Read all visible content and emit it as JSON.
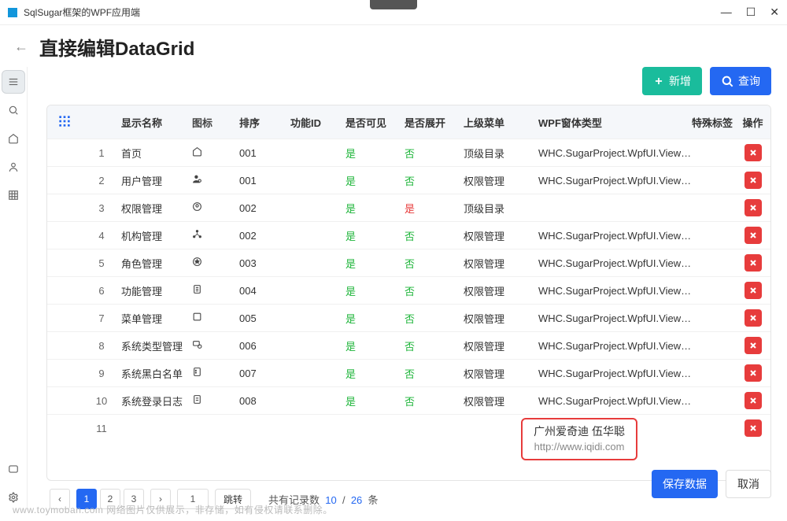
{
  "window": {
    "title": "SqlSugar框架的WPF应用端"
  },
  "page": {
    "title": "直接编辑DataGrid"
  },
  "actions": {
    "add": "新增",
    "search": "查询",
    "save": "保存数据",
    "cancel": "取消"
  },
  "grid": {
    "headers": {
      "name": "显示名称",
      "icon": "图标",
      "sort": "排序",
      "func_id": "功能ID",
      "visible": "是否可见",
      "expand": "是否展开",
      "parent": "上级菜单",
      "winform": "WPF窗体类型",
      "tag": "特殊标签",
      "op": "操作"
    },
    "rows": [
      {
        "idx": "1",
        "name": "首页",
        "icon": "home",
        "sort": "001",
        "visible": "是",
        "expand": "否",
        "parent": "顶级目录",
        "winform": "WHC.SugarProject.WpfUI.Views...."
      },
      {
        "idx": "2",
        "name": "用户管理",
        "icon": "user",
        "sort": "001",
        "visible": "是",
        "expand": "否",
        "parent": "权限管理",
        "winform": "WHC.SugarProject.WpfUI.Views...."
      },
      {
        "idx": "3",
        "name": "权限管理",
        "icon": "shield",
        "sort": "002",
        "visible": "是",
        "expand": "是",
        "parent": "顶级目录",
        "winform": ""
      },
      {
        "idx": "4",
        "name": "机构管理",
        "icon": "org",
        "sort": "002",
        "visible": "是",
        "expand": "否",
        "parent": "权限管理",
        "winform": "WHC.SugarProject.WpfUI.Views...."
      },
      {
        "idx": "5",
        "name": "角色管理",
        "icon": "role",
        "sort": "003",
        "visible": "是",
        "expand": "否",
        "parent": "权限管理",
        "winform": "WHC.SugarProject.WpfUI.Views...."
      },
      {
        "idx": "6",
        "name": "功能管理",
        "icon": "func",
        "sort": "004",
        "visible": "是",
        "expand": "否",
        "parent": "权限管理",
        "winform": "WHC.SugarProject.WpfUI.Views...."
      },
      {
        "idx": "7",
        "name": "菜单管理",
        "icon": "menu",
        "sort": "005",
        "visible": "是",
        "expand": "否",
        "parent": "权限管理",
        "winform": "WHC.SugarProject.WpfUI.Views...."
      },
      {
        "idx": "8",
        "name": "系统类型管理",
        "icon": "sys",
        "sort": "006",
        "visible": "是",
        "expand": "否",
        "parent": "权限管理",
        "winform": "WHC.SugarProject.WpfUI.Views...."
      },
      {
        "idx": "9",
        "name": "系统黑白名单",
        "icon": "list",
        "sort": "007",
        "visible": "是",
        "expand": "否",
        "parent": "权限管理",
        "winform": "WHC.SugarProject.WpfUI.Views...."
      },
      {
        "idx": "10",
        "name": "系统登录日志",
        "icon": "log",
        "sort": "008",
        "visible": "是",
        "expand": "否",
        "parent": "权限管理",
        "winform": "WHC.SugarProject.WpfUI.Views...."
      },
      {
        "idx": "11",
        "name": "",
        "icon": "",
        "sort": "",
        "visible": "",
        "expand": "",
        "parent": "",
        "winform": ""
      }
    ]
  },
  "pager": {
    "pages": [
      "1",
      "2",
      "3"
    ],
    "active": "1",
    "goto": "1",
    "jump": "跳转",
    "total_label_prefix": "共有记录数",
    "total": "10",
    "sep": "/",
    "page_total": "26",
    "total_label_suffix": "条"
  },
  "watermark": {
    "line1": "广州爱奇迪 伍华聪",
    "line2": "http://www.iqidi.com"
  },
  "footer_note": "www.toymoban.com 网络图片仅供展示，非存储，如有侵权请联系删除。"
}
